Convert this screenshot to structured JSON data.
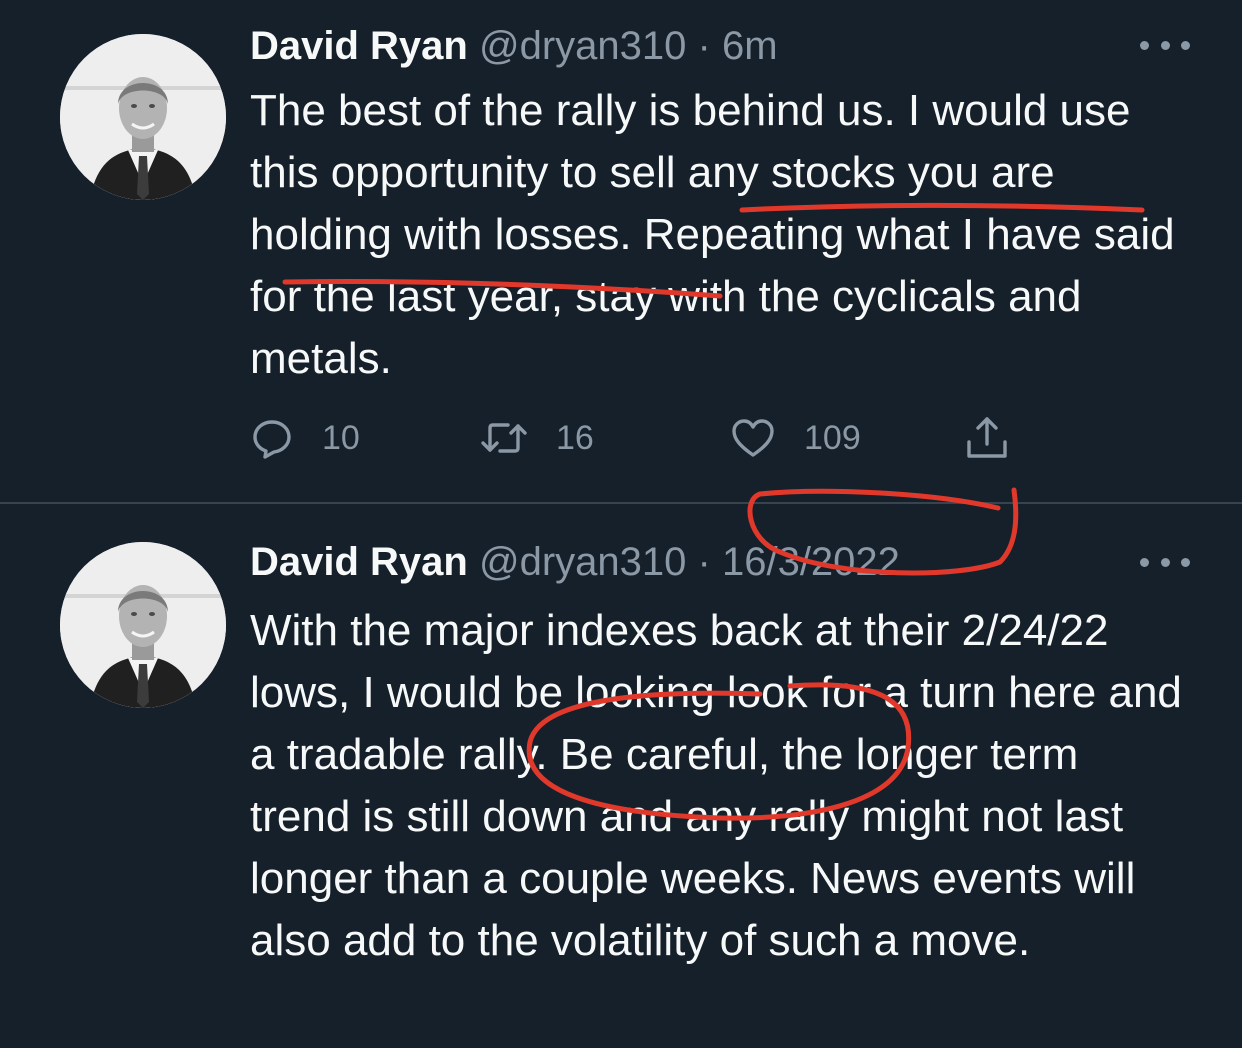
{
  "tweets": [
    {
      "author_name": "David Ryan",
      "handle": "@dryan310",
      "separator": "·",
      "time": "6m",
      "text": "The best of the rally is behind us. I would use this opportunity to sell any stocks you are holding with losses. Repeating what I have said for the last year, stay with the cyclicals and metals.",
      "reply_count": "10",
      "retweet_count": "16",
      "like_count": "109"
    },
    {
      "author_name": "David Ryan",
      "handle": "@dryan310",
      "separator": "·",
      "time": "16/3/2022",
      "text": "With the major indexes back at their 2/24/22 lows, I would be looking look for a turn here and a tradable rally. Be careful, the longer term trend is still down and any rally might not last longer than a couple weeks. News events will also add to the volatility of such a move."
    }
  ],
  "icons": {
    "reply": "reply-icon",
    "retweet": "retweet-icon",
    "like": "heart-icon",
    "share": "share-icon",
    "more": "more-icon"
  },
  "colors": {
    "background": "#15202b",
    "text": "#f7f9f9",
    "secondary": "#8b98a5",
    "divider": "#38444d",
    "annotation": "#e0392b"
  }
}
